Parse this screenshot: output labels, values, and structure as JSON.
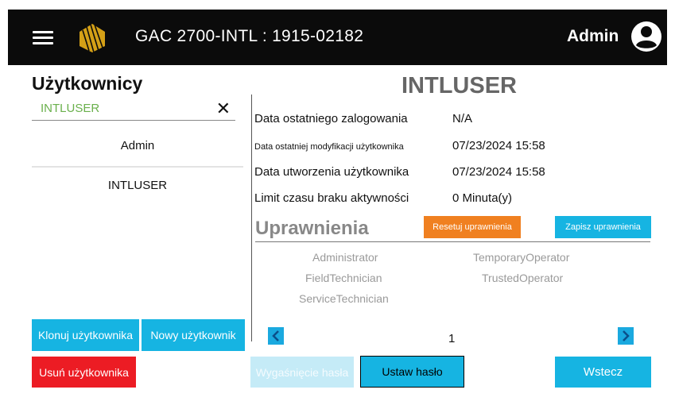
{
  "header": {
    "title": "GAC 2700-INTL : 1915-02182",
    "user_label": "Admin",
    "icons": {
      "menu": "hamburger-menu-icon",
      "logo": "gac-logo-icon",
      "user": "account-circle-icon"
    }
  },
  "sidebar": {
    "title": "Użytkownicy",
    "search": {
      "value": "INTLUSER",
      "placeholder": ""
    },
    "users": [
      {
        "label": "Admin"
      },
      {
        "label": "INTLUSER"
      }
    ],
    "buttons": {
      "clone": "Klonuj użytkownika",
      "new": "Nowy użytkownik",
      "delete": "Usuń użytkownika"
    }
  },
  "details": {
    "username": "INTLUSER",
    "rows": [
      {
        "label": "Data ostatniego zalogowania",
        "value": "N/A"
      },
      {
        "label": "Data ostatniej modyfikacji użytkownika",
        "value": "07/23/2024 15:58"
      },
      {
        "label": "Data utworzenia użytkownika",
        "value": "07/23/2024 15:58"
      },
      {
        "label": "Limit czasu braku aktywności",
        "value": "0 Minuta(y)"
      }
    ]
  },
  "permissions": {
    "title": "Uprawnienia",
    "reset_label": "Resetuj uprawnienia",
    "save_label": "Zapisz uprawnienia",
    "items": [
      "Administrator",
      "TemporaryOperator",
      "FieldTechnician",
      "TrustedOperator",
      "ServiceTechnician"
    ],
    "page": "1"
  },
  "footer": {
    "expire_label": "Wygaśnięcie hasła",
    "set_password_label": "Ustaw hasło",
    "back_label": "Wstecz"
  },
  "colors": {
    "header_bg": "#0b0b0b",
    "accent": "#16b4e2",
    "orange": "#f08020",
    "danger": "#ec1c24",
    "search_text": "#6ab04c",
    "disabled": "#c5ebf7"
  }
}
